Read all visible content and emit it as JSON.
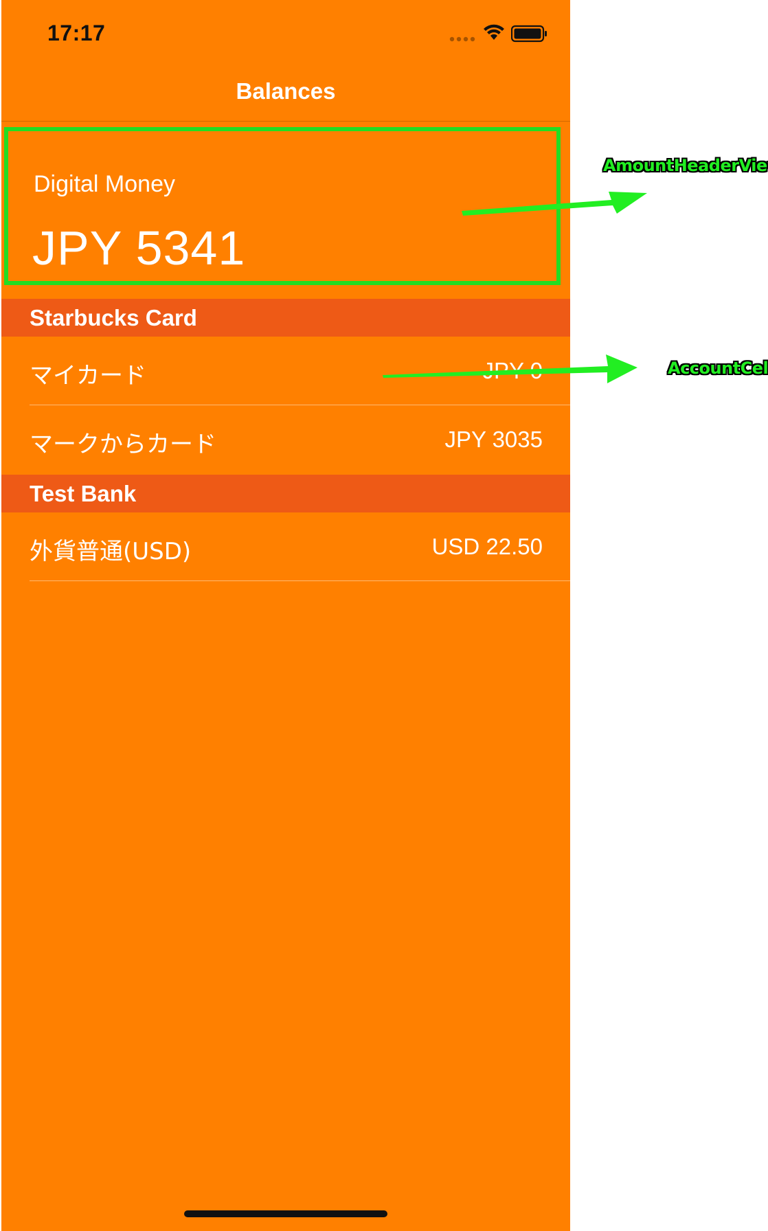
{
  "status_bar": {
    "time": "17:17"
  },
  "nav": {
    "title": "Balances"
  },
  "amount_header": {
    "label": "Digital Money",
    "amount": "JPY 5341"
  },
  "sections": [
    {
      "title": "Starbucks Card",
      "accounts": [
        {
          "name": "マイカード",
          "balance": "JPY 0"
        },
        {
          "name": "マークからカード",
          "balance": "JPY 3035"
        }
      ]
    },
    {
      "title": "Test Bank",
      "accounts": [
        {
          "name": "外貨普通(USD)",
          "balance": "USD 22.50"
        }
      ]
    }
  ],
  "annotations": {
    "amount_header_view": "AmountHeaderView",
    "account_cell": "AccountCell"
  },
  "colors": {
    "background": "#ff8000",
    "section_header": "#ee5a16",
    "annotation": "#22ee22",
    "text": "#ffffff"
  },
  "icons": [
    "signal-icon",
    "wifi-icon",
    "battery-icon"
  ]
}
